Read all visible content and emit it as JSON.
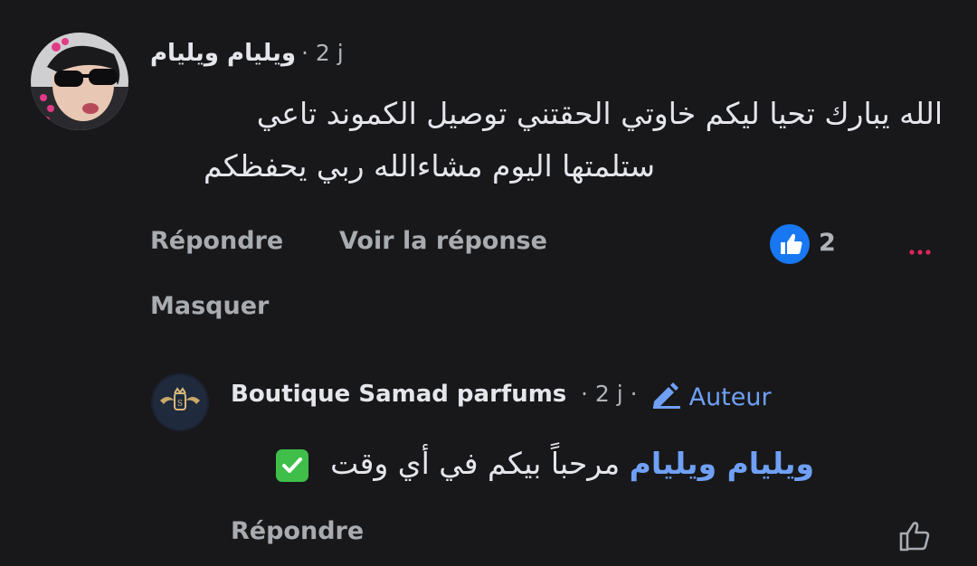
{
  "comment": {
    "author": "ويليام ويليام",
    "time": "· 2 j",
    "text_line1": "الله يبارك تحيا ليكم خاوتي الحقتني توصيل الكموند تاعي",
    "text_line2": "ستلمتها اليوم مشاءالله ربي يحفظكم",
    "actions": {
      "reply": "Répondre",
      "view_reply": "Voir la réponse",
      "hide": "Masquer"
    },
    "reaction_count": "2"
  },
  "reply": {
    "author": "Boutique Samad parfums",
    "time": "· 2 j ·",
    "author_badge": "Auteur",
    "mention": "ويليام ويليام",
    "text": "مرحباً بيكم في أي وقت",
    "actions": {
      "reply": "Répondre"
    }
  },
  "colors": {
    "background": "#18181a",
    "link_blue": "#6fa0f5",
    "like_blue": "#1877f2",
    "check_green": "#3fbf49",
    "more_red": "#e0245e"
  }
}
